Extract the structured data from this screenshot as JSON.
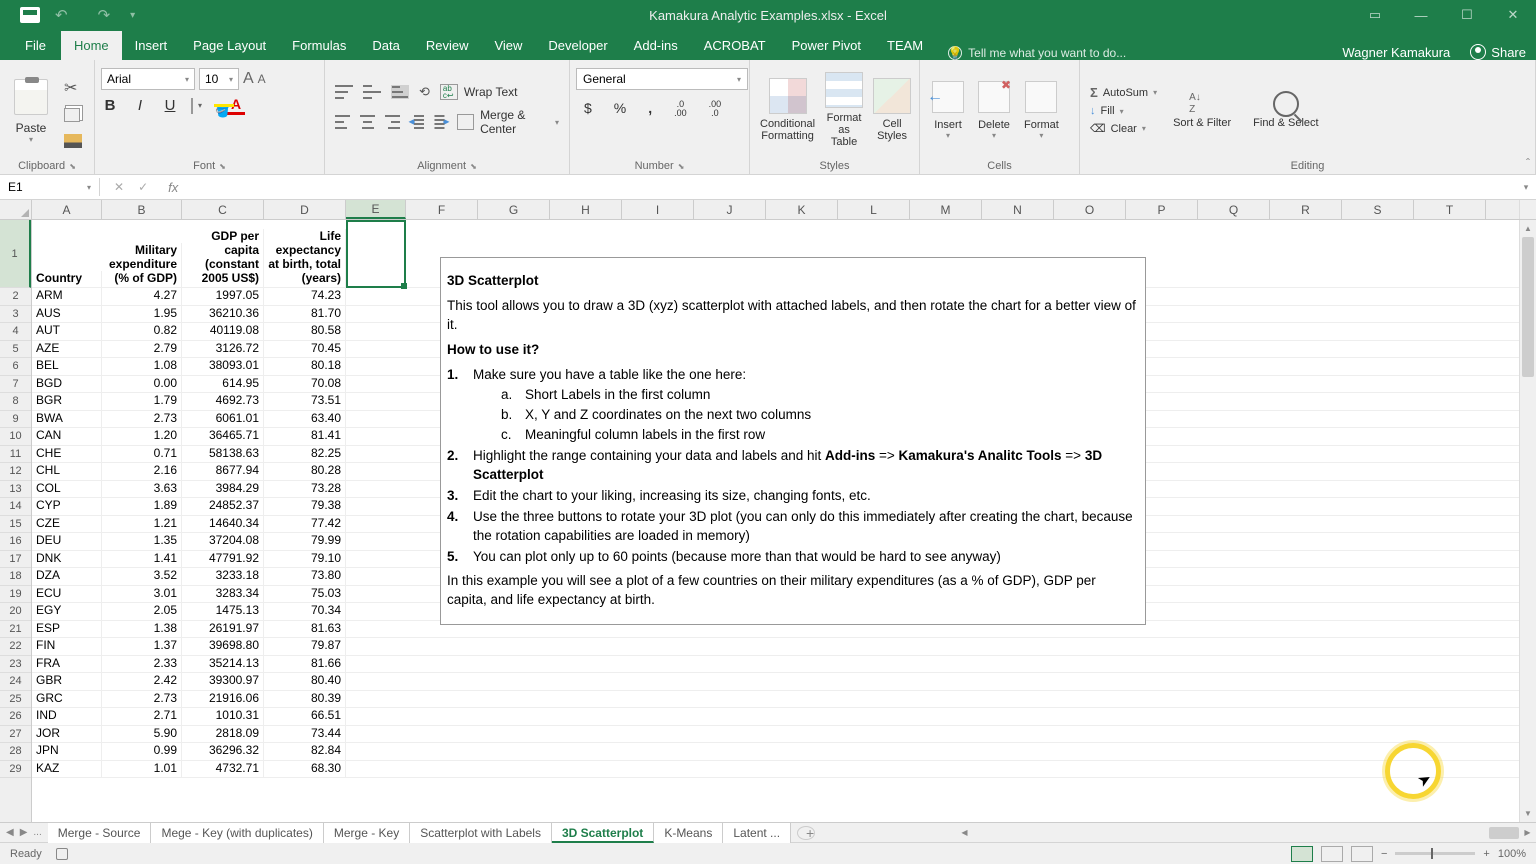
{
  "titlebar": {
    "title": "Kamakura Analytic Examples.xlsx - Excel"
  },
  "tabs": {
    "file": "File",
    "home": "Home",
    "insert": "Insert",
    "page_layout": "Page Layout",
    "formulas": "Formulas",
    "data": "Data",
    "review": "Review",
    "view": "View",
    "developer": "Developer",
    "addins": "Add-ins",
    "acrobat": "ACROBAT",
    "power_pivot": "Power Pivot",
    "team": "TEAM",
    "tell_me": "Tell me what you want to do...",
    "user": "Wagner Kamakura",
    "share": "Share"
  },
  "ribbon": {
    "clipboard": {
      "label": "Clipboard",
      "paste": "Paste"
    },
    "font": {
      "label": "Font",
      "name": "Arial",
      "size": "10"
    },
    "alignment": {
      "label": "Alignment",
      "wrap": "Wrap Text",
      "merge": "Merge & Center"
    },
    "number": {
      "label": "Number",
      "format": "General"
    },
    "styles": {
      "label": "Styles",
      "cond_fmt": "Conditional Formatting",
      "fmt_table": "Format as Table",
      "cell_styles": "Cell Styles"
    },
    "cells": {
      "label": "Cells",
      "insert": "Insert",
      "delete": "Delete",
      "format": "Format"
    },
    "editing": {
      "label": "Editing",
      "autosum": "AutoSum",
      "fill": "Fill",
      "clear": "Clear",
      "sort": "Sort & Filter",
      "find": "Find & Select"
    }
  },
  "namebox": "E1",
  "columns": [
    "A",
    "B",
    "C",
    "D",
    "E",
    "F",
    "G",
    "H",
    "I",
    "J",
    "K",
    "L",
    "M",
    "N",
    "O",
    "P",
    "Q",
    "R",
    "S",
    "T"
  ],
  "headers": {
    "A": "Country",
    "B": "Military expenditure (% of GDP)",
    "C": "GDP per capita (constant 2005 US$)",
    "D": "Life expectancy at birth, total (years)"
  },
  "rows": [
    {
      "n": 2,
      "A": "ARM",
      "B": "4.27",
      "C": "1997.05",
      "D": "74.23"
    },
    {
      "n": 3,
      "A": "AUS",
      "B": "1.95",
      "C": "36210.36",
      "D": "81.70"
    },
    {
      "n": 4,
      "A": "AUT",
      "B": "0.82",
      "C": "40119.08",
      "D": "80.58"
    },
    {
      "n": 5,
      "A": "AZE",
      "B": "2.79",
      "C": "3126.72",
      "D": "70.45"
    },
    {
      "n": 6,
      "A": "BEL",
      "B": "1.08",
      "C": "38093.01",
      "D": "80.18"
    },
    {
      "n": 7,
      "A": "BGD",
      "B": "0.00",
      "C": "614.95",
      "D": "70.08"
    },
    {
      "n": 8,
      "A": "BGR",
      "B": "1.79",
      "C": "4692.73",
      "D": "73.51"
    },
    {
      "n": 9,
      "A": "BWA",
      "B": "2.73",
      "C": "6061.01",
      "D": "63.40"
    },
    {
      "n": 10,
      "A": "CAN",
      "B": "1.20",
      "C": "36465.71",
      "D": "81.41"
    },
    {
      "n": 11,
      "A": "CHE",
      "B": "0.71",
      "C": "58138.63",
      "D": "82.25"
    },
    {
      "n": 12,
      "A": "CHL",
      "B": "2.16",
      "C": "8677.94",
      "D": "80.28"
    },
    {
      "n": 13,
      "A": "COL",
      "B": "3.63",
      "C": "3984.29",
      "D": "73.28"
    },
    {
      "n": 14,
      "A": "CYP",
      "B": "1.89",
      "C": "24852.37",
      "D": "79.38"
    },
    {
      "n": 15,
      "A": "CZE",
      "B": "1.21",
      "C": "14640.34",
      "D": "77.42"
    },
    {
      "n": 16,
      "A": "DEU",
      "B": "1.35",
      "C": "37204.08",
      "D": "79.99"
    },
    {
      "n": 17,
      "A": "DNK",
      "B": "1.41",
      "C": "47791.92",
      "D": "79.10"
    },
    {
      "n": 18,
      "A": "DZA",
      "B": "3.52",
      "C": "3233.18",
      "D": "73.80"
    },
    {
      "n": 19,
      "A": "ECU",
      "B": "3.01",
      "C": "3283.34",
      "D": "75.03"
    },
    {
      "n": 20,
      "A": "EGY",
      "B": "2.05",
      "C": "1475.13",
      "D": "70.34"
    },
    {
      "n": 21,
      "A": "ESP",
      "B": "1.38",
      "C": "26191.97",
      "D": "81.63"
    },
    {
      "n": 22,
      "A": "FIN",
      "B": "1.37",
      "C": "39698.80",
      "D": "79.87"
    },
    {
      "n": 23,
      "A": "FRA",
      "B": "2.33",
      "C": "35214.13",
      "D": "81.66"
    },
    {
      "n": 24,
      "A": "GBR",
      "B": "2.42",
      "C": "39300.97",
      "D": "80.40"
    },
    {
      "n": 25,
      "A": "GRC",
      "B": "2.73",
      "C": "21916.06",
      "D": "80.39"
    },
    {
      "n": 26,
      "A": "IND",
      "B": "2.71",
      "C": "1010.31",
      "D": "66.51"
    },
    {
      "n": 27,
      "A": "JOR",
      "B": "5.90",
      "C": "2818.09",
      "D": "73.44"
    },
    {
      "n": 28,
      "A": "JPN",
      "B": "0.99",
      "C": "36296.32",
      "D": "82.84"
    },
    {
      "n": 29,
      "A": "KAZ",
      "B": "1.01",
      "C": "4732.71",
      "D": "68.30"
    }
  ],
  "textbox": {
    "title": "3D Scatterplot",
    "intro": "This tool allows you to draw a 3D (xyz) scatterplot with attached labels, and then rotate the chart for a better view of it.",
    "howto": "How to use it?",
    "step1": "Make sure you have a table like the one here:",
    "s1a": "Short Labels in the first column",
    "s1b": "X, Y and Z coordinates on the next two columns",
    "s1c": "Meaningful column labels in the first row",
    "step2a": "Highlight the range containing your data and labels and hit ",
    "step2b": " => ",
    "addin": "Add-ins",
    "tool": "Kamakura's Analitc Tools",
    "scatter": "3D Scatterplot",
    "step3": "Edit the chart to your liking, increasing its size, changing fonts, etc.",
    "step4": "Use the three buttons to rotate your 3D plot (you can only do this immediately after creating the chart, because the rotation capabilities are loaded in memory)",
    "step5": "You can plot only up to 60 points (because more than that would be hard to see anyway)",
    "example": "In this example you will see a plot of a few countries on their military expenditures (as a % of GDP), GDP per capita, and life expectancy at birth."
  },
  "sheet_tabs": {
    "t1": "Merge - Source",
    "t2": "Mege - Key (with duplicates)",
    "t3": "Merge - Key",
    "t4": "Scatterplot with Labels",
    "t5": "3D Scatterplot",
    "t6": "K-Means",
    "t7": "Latent ..."
  },
  "statusbar": {
    "ready": "Ready",
    "zoom": "100%"
  }
}
